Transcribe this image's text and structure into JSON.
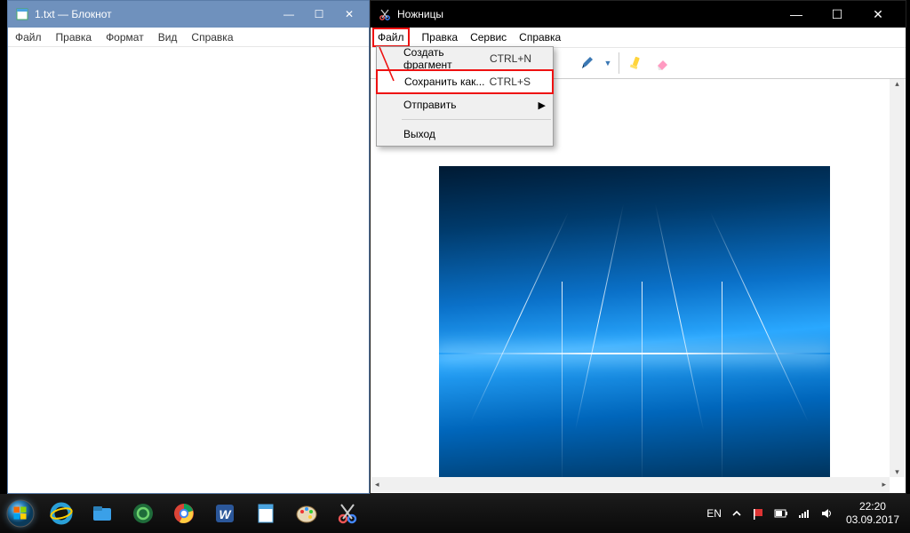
{
  "notepad": {
    "title": "1.txt — Блокнот",
    "menu": {
      "file": "Файл",
      "edit": "Правка",
      "format": "Формат",
      "view": "Вид",
      "help": "Справка"
    }
  },
  "snip": {
    "title": "Ножницы",
    "menu": {
      "file": "Файл",
      "edit": "Правка",
      "service": "Сервис",
      "help": "Справка"
    },
    "dropdown": {
      "new": {
        "label": "Создать фрагмент",
        "shortcut": "CTRL+N"
      },
      "saveas": {
        "label": "Сохранить как...",
        "shortcut": "CTRL+S"
      },
      "send": {
        "label": "Отправить"
      },
      "exit": {
        "label": "Выход"
      }
    }
  },
  "tray": {
    "lang": "EN",
    "time": "22:20",
    "date": "03.09.2017"
  }
}
